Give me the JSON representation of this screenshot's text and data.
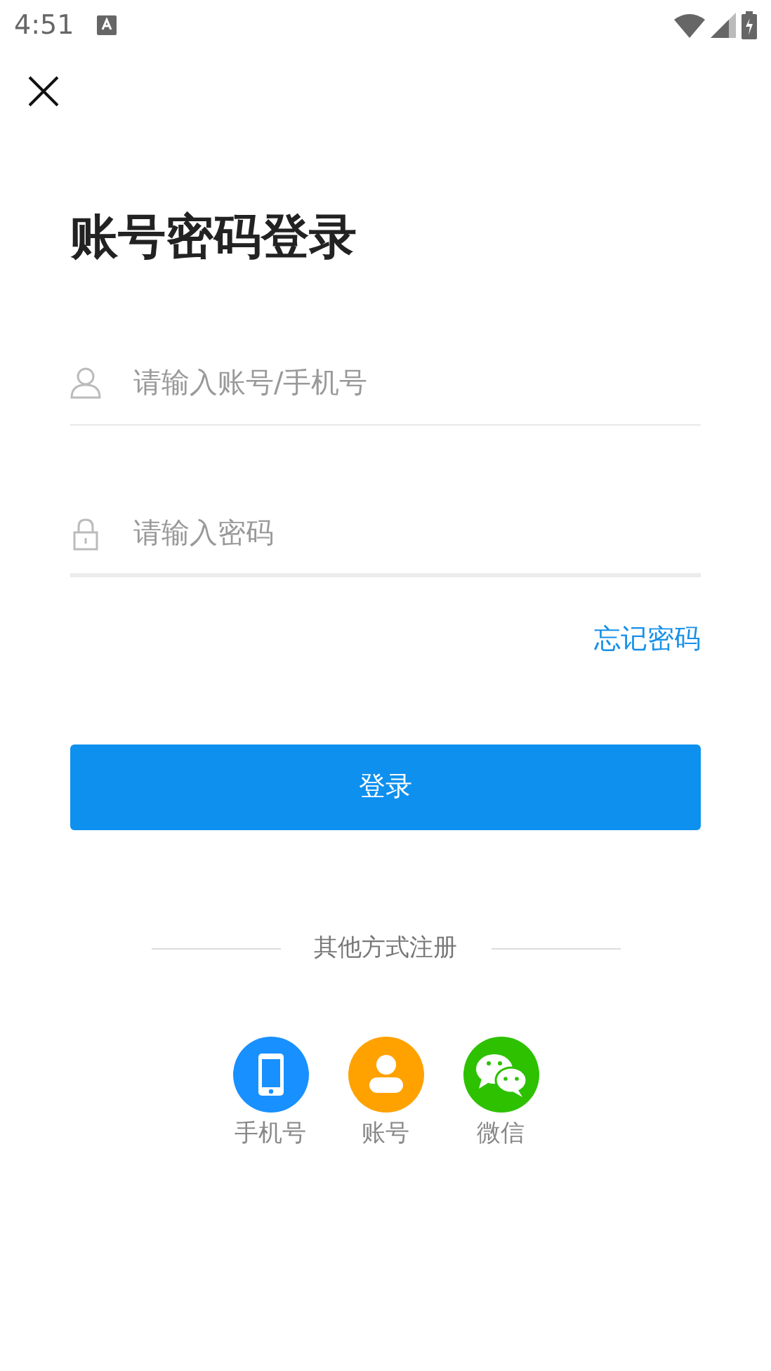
{
  "status_bar": {
    "time": "4:51"
  },
  "title": "账号密码登录",
  "fields": [
    {
      "kind": "account",
      "placeholder": "请输入账号/手机号",
      "focused": false
    },
    {
      "kind": "password",
      "placeholder": "请输入密码",
      "focused": true
    }
  ],
  "forgot_link": "忘记密码",
  "login_button": "登录",
  "divider_label": "其他方式注册",
  "options": [
    {
      "kind": "phone",
      "label": "手机号",
      "color": "#1890ff"
    },
    {
      "kind": "account",
      "label": "账号",
      "color": "#ffa200"
    },
    {
      "kind": "wechat",
      "label": "微信",
      "color": "#2dc100"
    }
  ]
}
